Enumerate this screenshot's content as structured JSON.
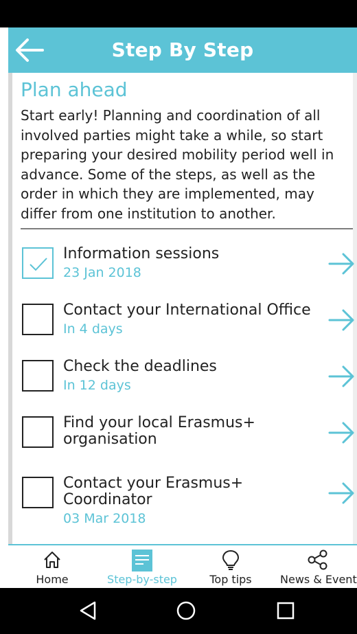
{
  "header": {
    "title": "Step By Step"
  },
  "section": {
    "title": "Plan ahead",
    "intro": "Start early! Planning and coordination of all involved parties might take a while, so start preparing your desired mobility period well in advance. Some of the steps, as well as the order in which they are implemented, may differ from one institution to another."
  },
  "steps": [
    {
      "label": "Information sessions",
      "date": "23 Jan 2018",
      "checked": true
    },
    {
      "label": "Contact your International Office",
      "date": "In 4 days",
      "checked": false
    },
    {
      "label": "Check the deadlines",
      "date": "In 12 days",
      "checked": false
    },
    {
      "label": "Find your local Erasmus+ organisation",
      "date": "",
      "checked": false
    },
    {
      "label": "Contact your Erasmus+ Coordinator",
      "date": "03 Mar 2018",
      "checked": false
    }
  ],
  "nav": {
    "home": "Home",
    "step_by_step": "Step-by-step",
    "top_tips": "Top tips",
    "news_events": "News & Events"
  },
  "colors": {
    "accent": "#5cc3d6",
    "text": "#222222"
  }
}
